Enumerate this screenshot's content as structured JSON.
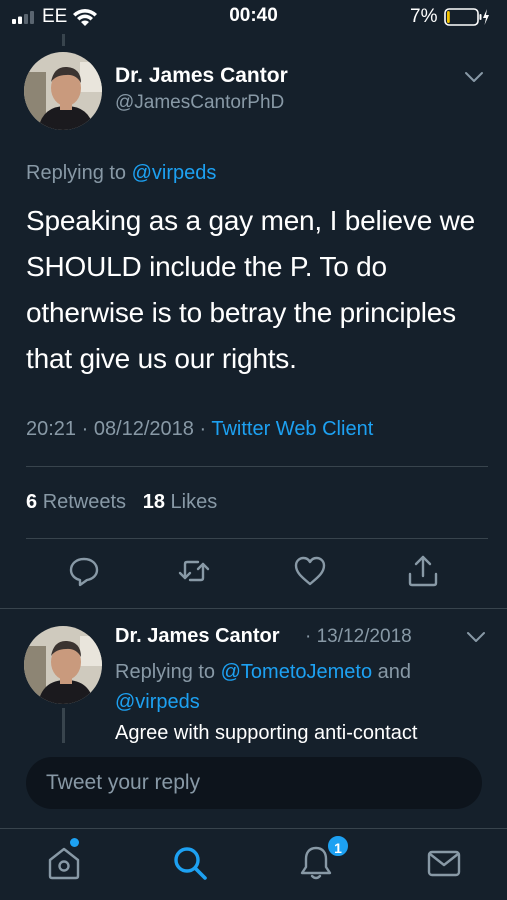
{
  "status_bar": {
    "carrier": "EE",
    "time": "00:40",
    "battery_percent": "7%",
    "battery_level": 0.07
  },
  "tweet": {
    "display_name": "Dr. James Cantor",
    "handle": "@JamesCantorPhD",
    "replying_prefix": "Replying to ",
    "replying_to": "@virpeds",
    "text": "Speaking as a gay men, I believe we SHOULD include the P.  To do otherwise is to betray the principles that give us our rights.",
    "timestamp": "20:21 · 08/12/2018 · ",
    "client": "Twitter Web Client",
    "retweets_count": "6",
    "retweets_label": "Retweets",
    "likes_count": "18",
    "likes_label": "Likes"
  },
  "reply": {
    "display_name": "Dr. James Cantor",
    "date": "· 13/12/2018",
    "replying_prefix": "Replying to ",
    "replying_to_1": "@TometoJemeto",
    "replying_and": " and",
    "replying_to_2": "@virpeds",
    "text": "Agree with supporting anti-contact"
  },
  "composer": {
    "placeholder": "Tweet your reply"
  },
  "tabbar": {
    "notifications_badge": "1"
  },
  "colors": {
    "background": "#15202b",
    "accent": "#1da1f2",
    "secondary_text": "#8899a6",
    "divider": "#38444d"
  },
  "icons": [
    "signal-icon",
    "wifi-icon",
    "battery-icon",
    "chevron-down-icon",
    "reply-icon",
    "retweet-icon",
    "heart-icon",
    "share-icon",
    "home-icon",
    "search-icon",
    "bell-icon",
    "mail-icon"
  ]
}
